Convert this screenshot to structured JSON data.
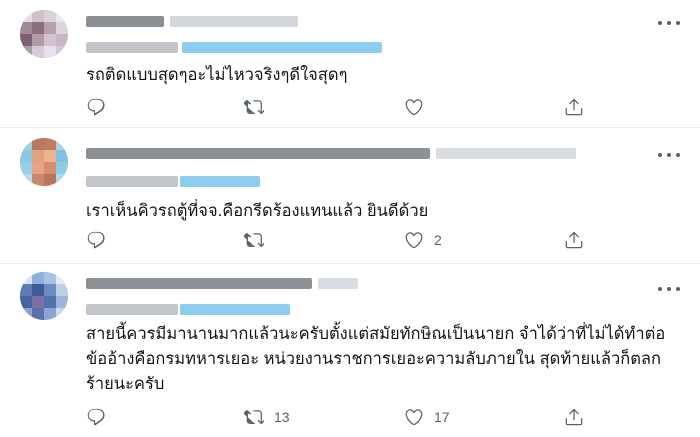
{
  "tweets": [
    {
      "text": "รถติดแบบสุดๆอะไม่ไหวจริงๆดีใจสุดๆ",
      "reply_count": "",
      "retweet_count": "",
      "like_count": ""
    },
    {
      "text": "เราเห็นคิวรถตู้ที่จจ.คือกรีดร้องแทนแล้ว ยินดีด้วย",
      "reply_count": "",
      "retweet_count": "",
      "like_count": "2"
    },
    {
      "text_lines": [
        "สายนี้ควรมีมานานมากแล้วนะครับตั้งแต่สมัยทักษิณเป็นนายก จำได้ว่าที่ไม่ได้ทำต่อ",
        "ข้ออ้างคือกรมทหารเยอะ หน่วยงานราชการเยอะความลับภายใน สุดท้ายแล้วก็ตลก",
        "ร้ายนะครับ"
      ],
      "reply_count": "",
      "retweet_count": "13",
      "like_count": "17"
    }
  ],
  "icons": {
    "reply": "reply-icon",
    "retweet": "retweet-icon",
    "like": "heart-icon",
    "share": "share-icon",
    "more": "more-options-icon"
  },
  "colors": {
    "text": "#0f1419",
    "secondary": "#536471",
    "divider": "#e6ecf0",
    "blurred_link": "#8ecdf2",
    "blurred_name": "#9aa0a6"
  }
}
